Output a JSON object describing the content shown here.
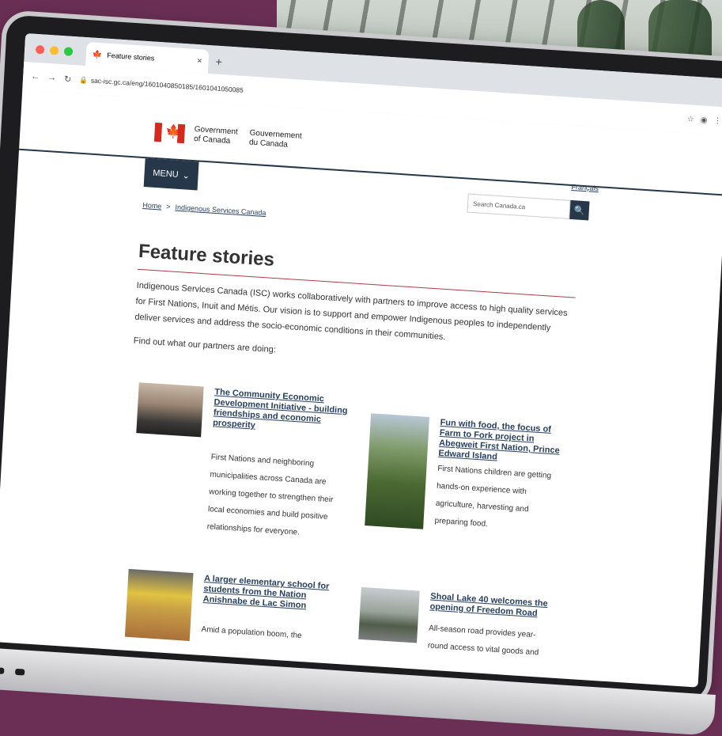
{
  "browser": {
    "tab_title": "Feature stories",
    "tab_close": "×",
    "new_tab": "+",
    "url": "sac-isc.gc.ca/eng/1601040850185/1601041050085",
    "traffic_colors": [
      "#ff5f57",
      "#febc2e",
      "#28c840"
    ]
  },
  "header": {
    "signature_en_line1": "Government",
    "signature_en_line2": "of Canada",
    "signature_fr_line1": "Gouvernement",
    "signature_fr_line2": "du Canada",
    "language_toggle": "Français",
    "menu_label": "MENU",
    "search_placeholder": "Search Canada.ca",
    "accent": "#26374a",
    "flag_red": "#d52b1e"
  },
  "breadcrumb": {
    "home": "Home",
    "separator": ">",
    "current": "Indigenous Services Canada"
  },
  "main": {
    "title": "Feature stories",
    "intro": "Indigenous Services Canada (ISC) works collaboratively with partners to improve access to high quality services for First Nations, Inuit and Métis. Our vision is to support and empower Indigenous peoples to independently deliver services and address the socio-economic conditions in their communities.",
    "find_out": "Find out what our partners are doing:"
  },
  "cards": [
    {
      "title": "The Community Economic Development Initiative - building friendships and economic prosperity",
      "description": "First Nations and neighboring municipalities across Canada are working together to strengthen their local economies and build positive relationships for everyone."
    },
    {
      "title": "Fun with food, the focus of Farm to Fork project in Abegweit First Nation, Prince Edward Island",
      "description": "First Nations children are getting hands-on experience with agriculture, harvesting and preparing food."
    },
    {
      "title": "A larger elementary school for students from the Nation Anishnabe de Lac Simon",
      "description": "Amid a population boom, the"
    },
    {
      "title": "Shoal Lake 40 welcomes the opening of Freedom Road",
      "description": "All-season road provides year-round access to vital goods and"
    }
  ]
}
